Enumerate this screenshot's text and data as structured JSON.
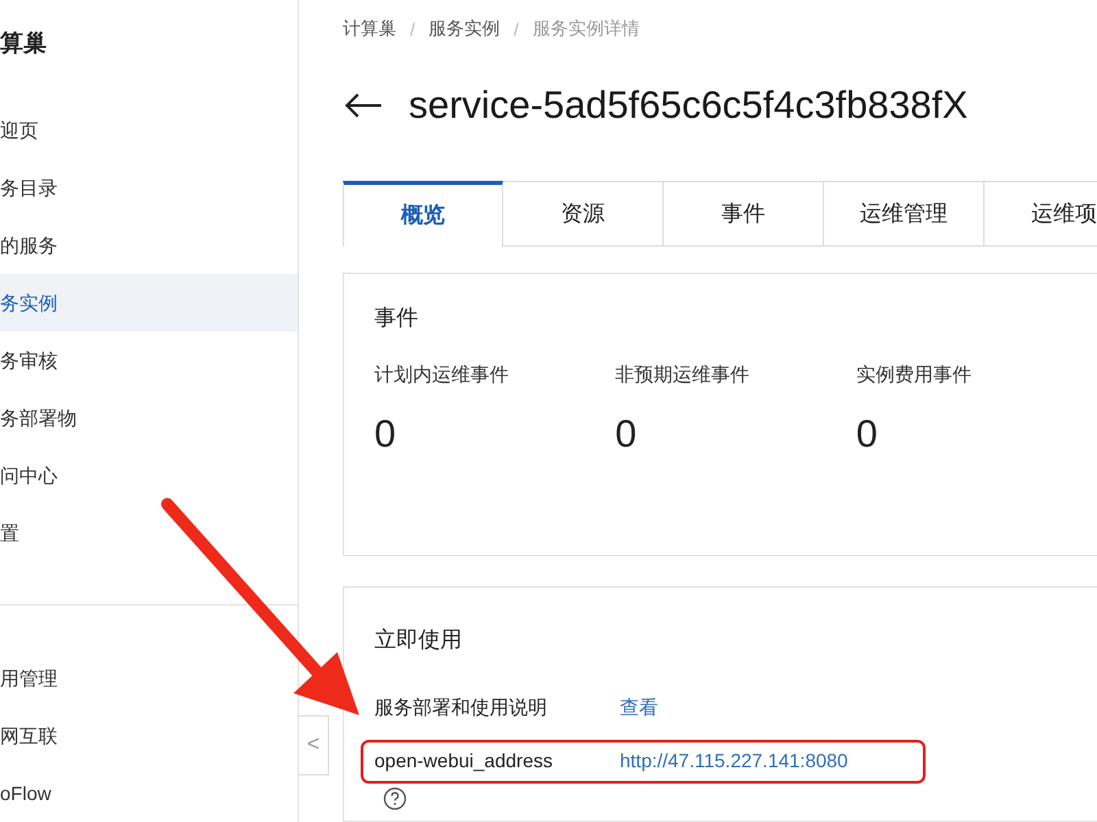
{
  "sidebar": {
    "title": "算巢",
    "items": [
      {
        "label": "迎页",
        "selected": false
      },
      {
        "label": "务目录",
        "selected": false
      },
      {
        "label": "的服务",
        "selected": false
      },
      {
        "label": "务实例",
        "selected": true
      },
      {
        "label": "务审核",
        "selected": false
      },
      {
        "label": "务部署物",
        "selected": false
      },
      {
        "label": "问中心",
        "selected": false
      },
      {
        "label": "置",
        "selected": false
      }
    ],
    "bottom_items": [
      {
        "label": "用管理",
        "selected": false
      },
      {
        "label": "网互联",
        "selected": false
      },
      {
        "label": "oFlow",
        "selected": false
      }
    ],
    "collapse_button": "<"
  },
  "breadcrumb": {
    "items": [
      "计算巢",
      "服务实例",
      "服务实例详情"
    ],
    "separator": "/"
  },
  "page_title": "service-5ad5f65c6c5f4c3fb838fX",
  "tabs": [
    {
      "label": "概览",
      "selected": true
    },
    {
      "label": "资源",
      "selected": false
    },
    {
      "label": "事件",
      "selected": false
    },
    {
      "label": "运维管理",
      "selected": false
    },
    {
      "label": "运维项",
      "selected": false
    }
  ],
  "events_card": {
    "title": "事件",
    "stats": [
      {
        "label": "计划内运维事件",
        "value": "0"
      },
      {
        "label": "非预期运维事件",
        "value": "0"
      },
      {
        "label": "实例费用事件",
        "value": "0"
      }
    ]
  },
  "usage_card": {
    "title": "立即使用",
    "rows": [
      {
        "key": "服务部署和使用说明",
        "value": "查看",
        "highlighted": false,
        "help": false
      },
      {
        "key": "open-webui_address",
        "value": "http://47.115.227.141:8080",
        "highlighted": true,
        "help": true
      }
    ]
  }
}
